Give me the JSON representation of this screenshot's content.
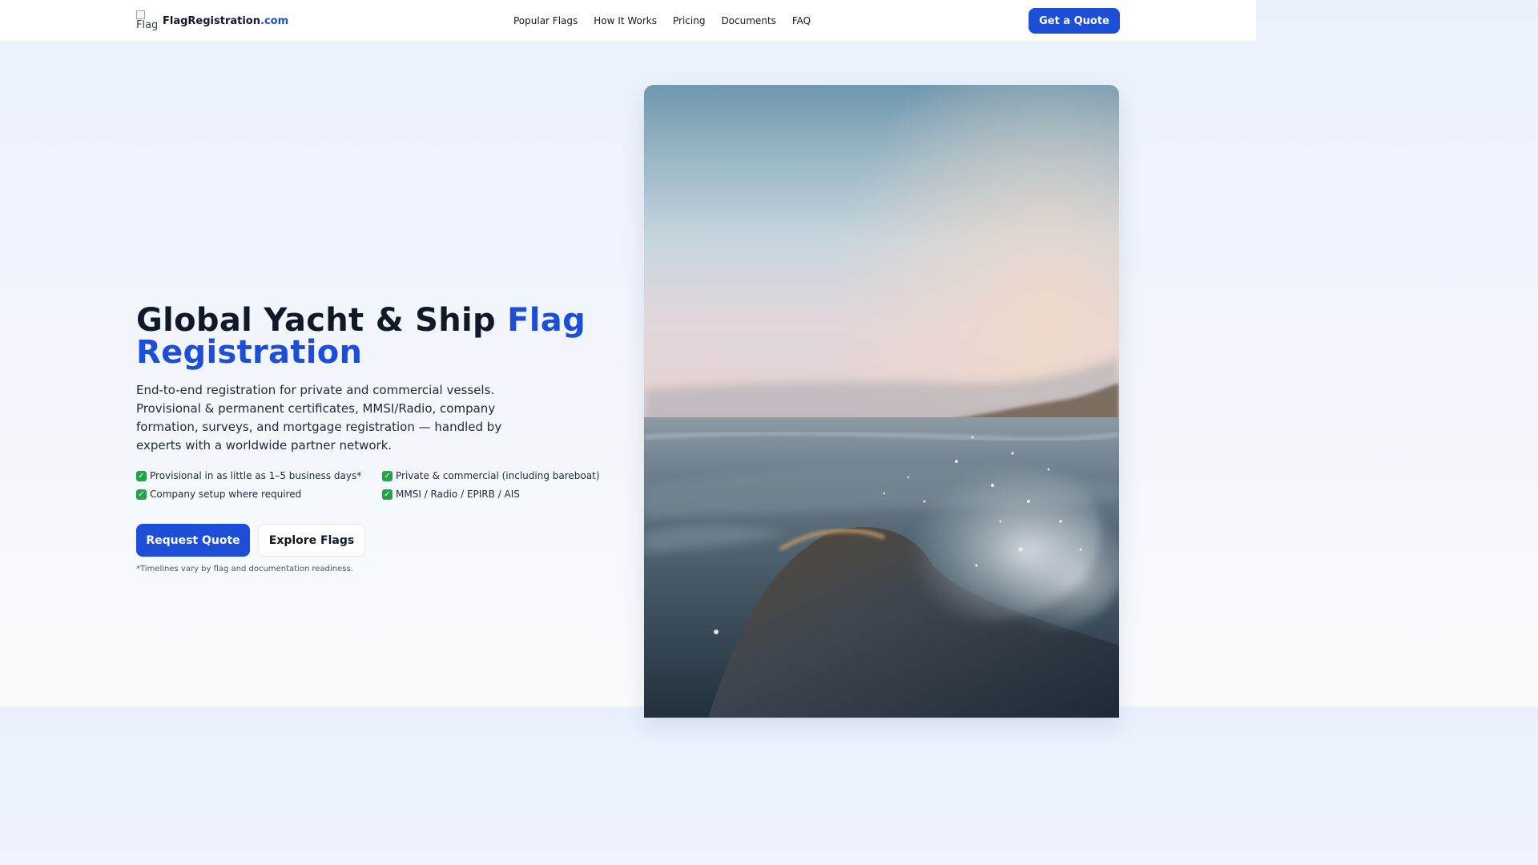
{
  "header": {
    "logo_alt": "Flag",
    "brand_name": "FlagRegistration",
    "brand_tld": ".com",
    "nav": [
      {
        "label": "Popular Flags"
      },
      {
        "label": "How It Works"
      },
      {
        "label": "Pricing"
      },
      {
        "label": "Documents"
      },
      {
        "label": "FAQ"
      }
    ],
    "cta_label": "Get a Quote"
  },
  "hero": {
    "title_main": "Global Yacht & Ship ",
    "title_accent": "Flag Registration",
    "description": "End-to-end registration for private and commercial vessels. Provisional & permanent certificates, MMSI/Radio, company formation, surveys, and mortgage registration — handled by experts with a worldwide partner network.",
    "features": [
      {
        "text": "Provisional in as little as 1–5 business days*"
      },
      {
        "text": "Private & commercial (including bareboat)"
      },
      {
        "text": "Company setup where required"
      },
      {
        "text": "MMSI / Radio / EPIRB / AIS"
      }
    ],
    "check_glyph": "✓",
    "primary_button": "Request Quote",
    "secondary_button": "Explore Flags",
    "footnote": "*Timelines vary by flag and documentation readiness."
  },
  "colors": {
    "accent": "#1d4ed8",
    "check": "#22a34a",
    "text": "#111827"
  },
  "icons": {
    "feature_icon": "check-mark-icon",
    "logo": "flag-logo-broken-image"
  }
}
